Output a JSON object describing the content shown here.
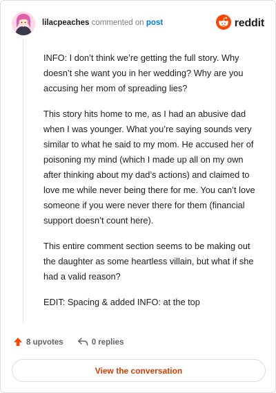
{
  "header": {
    "username": "lilacpeaches",
    "action_text": "commented on",
    "target_link": "post",
    "brand": "reddit",
    "brand_color": "#ff4500"
  },
  "comment": {
    "paragraphs": [
      "INFO: I don’t think we’re getting the full story. Why doesn’t she want you in her wedding? Why are you accusing her mom of spreading lies?",
      "This story hits home to me, as I had an abusive dad when I was younger. What you’re saying sounds very similar to what he said to my mom. He accused her of poisoning my mind (which I made up all on my own after thinking about my dad’s actions) and claimed to love me while never being there for me. You can’t love someone if you were never there for them (financial support doesn’t count here).",
      "This entire comment section seems to be making out the daughter as some heartless villain, but what if she had a valid reason?",
      "EDIT: Spacing & added INFO: at the top"
    ]
  },
  "actions": {
    "upvotes_label": "8 upvotes",
    "replies_label": "0 replies",
    "upvote_color": "#ff4500"
  },
  "cta": {
    "label": "View the conversation"
  },
  "icons": {
    "avatar": "user-avatar-icon",
    "brand": "reddit-logo-icon",
    "upvote": "arrow-up-icon",
    "reply": "reply-arrow-icon"
  }
}
